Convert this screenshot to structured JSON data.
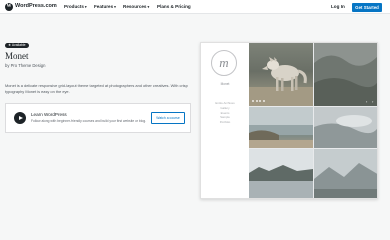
{
  "nav": {
    "logo_letter": "W",
    "brand": "WordPress.com",
    "items": [
      {
        "label": "Products",
        "chevron": "▾"
      },
      {
        "label": "Features",
        "chevron": "▾"
      },
      {
        "label": "Resources",
        "chevron": "▾"
      },
      {
        "label": "Plans & Pricing",
        "chevron": ""
      }
    ],
    "login": "Log In",
    "cta": "Get Started"
  },
  "theme": {
    "badge": "Available",
    "badge_icon": "★",
    "title": "Monet",
    "byline": "by Pro Theme Design",
    "description": "Monet is a delicate responsive grid-layout theme targeted at photographers and other creatives. With crisp typography Monet is easy on the eye."
  },
  "learn": {
    "title": "Learn WordPress",
    "text": "Follow along with beginner-friendly courses and build your first website or blog.",
    "button": "Watch a course"
  },
  "preview": {
    "logo_letter": "m",
    "site_title": "Monet",
    "menu": [
      "Entire Archives",
      "Gallery",
      "Events",
      "Sample",
      "Portfolio"
    ],
    "slider_prev": "‹",
    "slider_next": "›"
  },
  "colors": {
    "accent": "#0675c4",
    "dark": "#1d2327",
    "background": "#f6f7f7"
  },
  "icons": {
    "play": "play-icon",
    "logo": "wordpress-logo-icon"
  }
}
